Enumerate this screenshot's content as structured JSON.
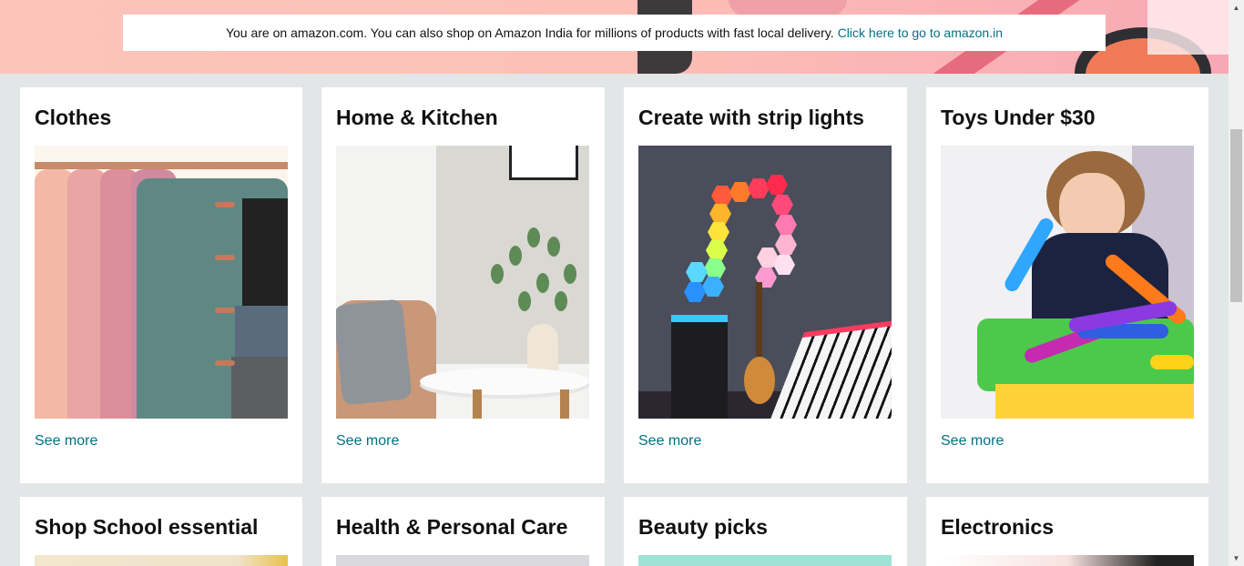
{
  "banner": {
    "notice_text": "You are on amazon.com. You can also shop on Amazon India for millions of products with fast local delivery.",
    "notice_link": "Click here to go to amazon.in"
  },
  "cards": [
    {
      "title": "Clothes",
      "link": "See more"
    },
    {
      "title": "Home & Kitchen",
      "link": "See more"
    },
    {
      "title": "Create with strip lights",
      "link": "See more"
    },
    {
      "title": "Toys Under $30",
      "link": "See more"
    },
    {
      "title": "Shop School essential"
    },
    {
      "title": "Health & Personal Care"
    },
    {
      "title": "Beauty picks"
    },
    {
      "title": "Electronics"
    }
  ],
  "icons": {
    "scroll_up": "▲",
    "scroll_down": "▼"
  },
  "colors": {
    "link": "#007185",
    "background": "#e3e6e6"
  }
}
